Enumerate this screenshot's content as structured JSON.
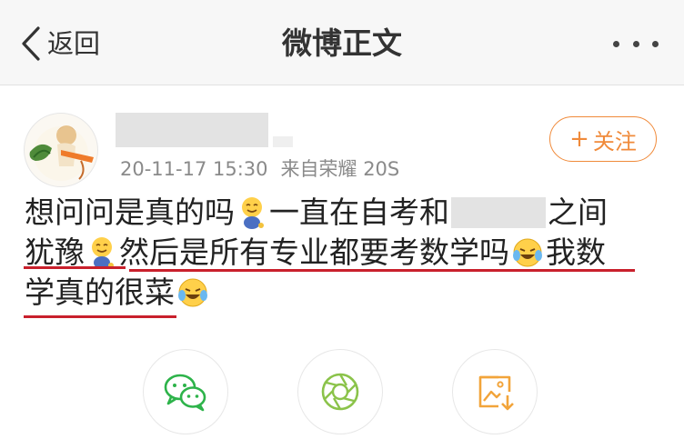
{
  "nav": {
    "back_label": "返回",
    "title": "微博正文"
  },
  "post": {
    "timestamp": "20-11-17 15:30",
    "source": "来自荣耀 20S",
    "follow_label": "关注",
    "lines": [
      {
        "a": "想问问是真的吗",
        "b": "一直在自考和",
        "c": "之间"
      },
      {
        "a": "犹豫",
        "b": "然后是所有专业都要考数学吗",
        "c": "我数"
      },
      {
        "a": "学真的很菜"
      }
    ]
  },
  "colors": {
    "accent": "#f08a3a",
    "underline": "#c9202c",
    "wechat": "#2db34a",
    "moments": "#8bc34a",
    "save_image": "#f2a43a"
  },
  "icons": [
    "back-chevron-icon",
    "more-dots-icon",
    "smiling-emoji-icon",
    "laughing-tears-emoji-icon",
    "wechat-icon",
    "moments-icon",
    "save-image-icon"
  ]
}
